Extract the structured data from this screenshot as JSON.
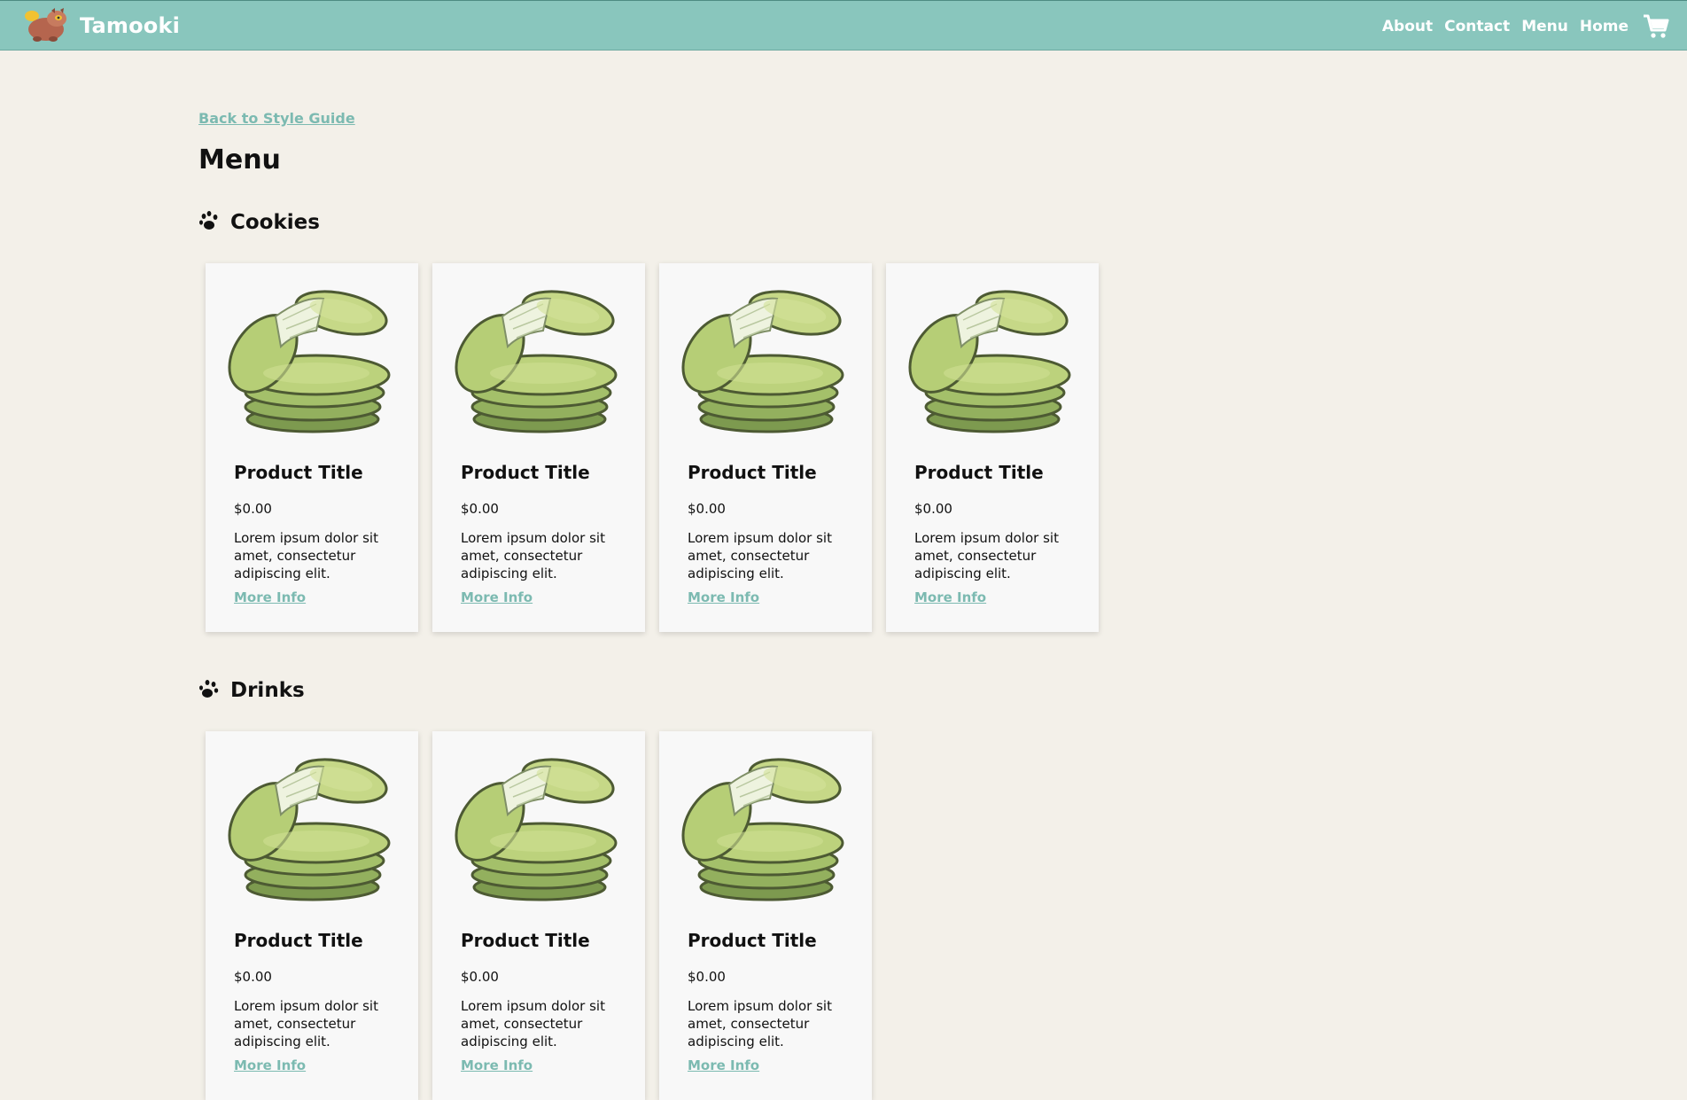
{
  "header": {
    "brand": "Tamooki",
    "nav": [
      "About",
      "Contact",
      "Menu",
      "Home"
    ]
  },
  "page": {
    "back_link": "Back to Style Guide",
    "title": "Menu"
  },
  "sections": [
    {
      "title": "Cookies",
      "products": [
        {
          "title": "Product Title",
          "price": "$0.00",
          "description": "Lorem ipsum dolor sit amet, consectetur adipiscing elit.",
          "link": "More Info"
        },
        {
          "title": "Product Title",
          "price": "$0.00",
          "description": "Lorem ipsum dolor sit amet, consectetur adipiscing elit.",
          "link": "More Info"
        },
        {
          "title": "Product Title",
          "price": "$0.00",
          "description": "Lorem ipsum dolor sit amet, consectetur adipiscing elit.",
          "link": "More Info"
        },
        {
          "title": "Product Title",
          "price": "$0.00",
          "description": "Lorem ipsum dolor sit amet, consectetur adipiscing elit.",
          "link": "More Info"
        }
      ]
    },
    {
      "title": "Drinks",
      "products": [
        {
          "title": "Product Title",
          "price": "$0.00",
          "description": "Lorem ipsum dolor sit amet, consectetur adipiscing elit.",
          "link": "More Info"
        },
        {
          "title": "Product Title",
          "price": "$0.00",
          "description": "Lorem ipsum dolor sit amet, consectetur adipiscing elit.",
          "link": "More Info"
        },
        {
          "title": "Product Title",
          "price": "$0.00",
          "description": "Lorem ipsum dolor sit amet, consectetur adipiscing elit.",
          "link": "More Info"
        }
      ]
    }
  ],
  "icons": {
    "logo": "raccoon-logo-icon",
    "cart": "shopping-cart-icon",
    "section": "paw-print-icon",
    "product": "cookie-stack-image"
  },
  "colors": {
    "header_bg": "#89c6bd",
    "page_bg": "#f3f0e9",
    "accent_link": "#7cbab1",
    "card_bg": "#f8f8f8"
  }
}
